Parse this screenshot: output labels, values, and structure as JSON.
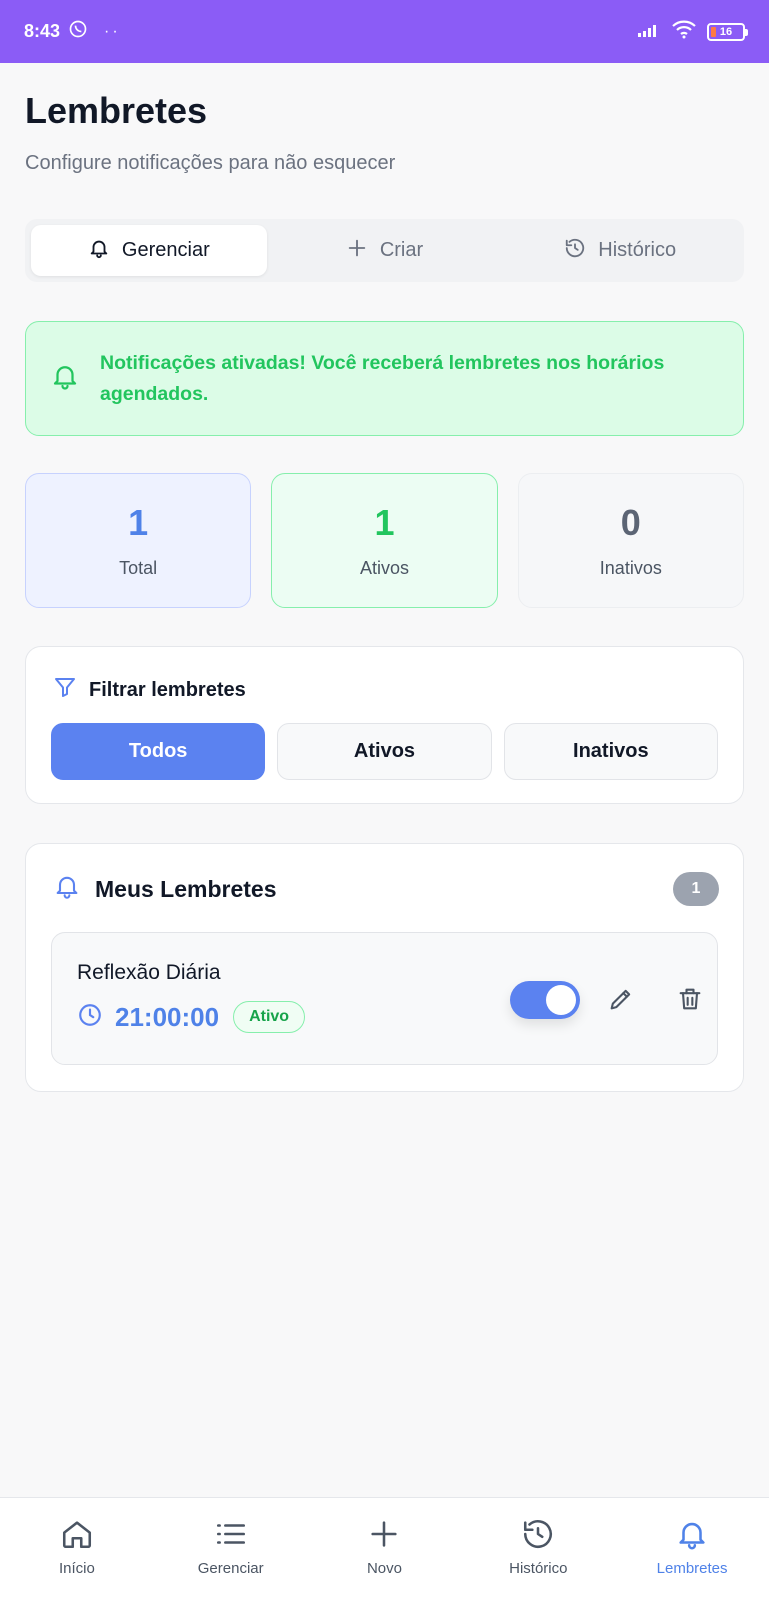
{
  "status_bar": {
    "time": "8:43",
    "dots": "··",
    "battery": "16"
  },
  "header": {
    "title": "Lembretes",
    "subtitle": "Configure notificações para não esquecer"
  },
  "tabs": [
    {
      "label": "Gerenciar",
      "icon": "bell-icon",
      "active": true
    },
    {
      "label": "Criar",
      "icon": "plus-icon",
      "active": false
    },
    {
      "label": "Histórico",
      "icon": "history-icon",
      "active": false
    }
  ],
  "notice": {
    "text": "Notificações ativadas! Você receberá lembretes nos horários agendados."
  },
  "stats": {
    "total": {
      "value": "1",
      "label": "Total"
    },
    "active": {
      "value": "1",
      "label": "Ativos"
    },
    "inactive": {
      "value": "0",
      "label": "Inativos"
    }
  },
  "filter": {
    "title": "Filtrar lembretes",
    "options": [
      "Todos",
      "Ativos",
      "Inativos"
    ],
    "selected": "Todos"
  },
  "reminders": {
    "title": "Meus Lembretes",
    "count": "1",
    "items": [
      {
        "title": "Reflexão Diária",
        "time": "21:00:00",
        "status": "Ativo",
        "enabled": true
      }
    ]
  },
  "bottom_nav": [
    {
      "label": "Início",
      "icon": "home-icon"
    },
    {
      "label": "Gerenciar",
      "icon": "list-icon"
    },
    {
      "label": "Novo",
      "icon": "plus-icon"
    },
    {
      "label": "Histórico",
      "icon": "history-icon"
    },
    {
      "label": "Lembretes",
      "icon": "bell-icon",
      "active": true
    }
  ],
  "colors": {
    "status_bar": "#8b5cf6",
    "accent": "#5b82f0",
    "success": "#22c55e",
    "muted": "#6b7280"
  }
}
